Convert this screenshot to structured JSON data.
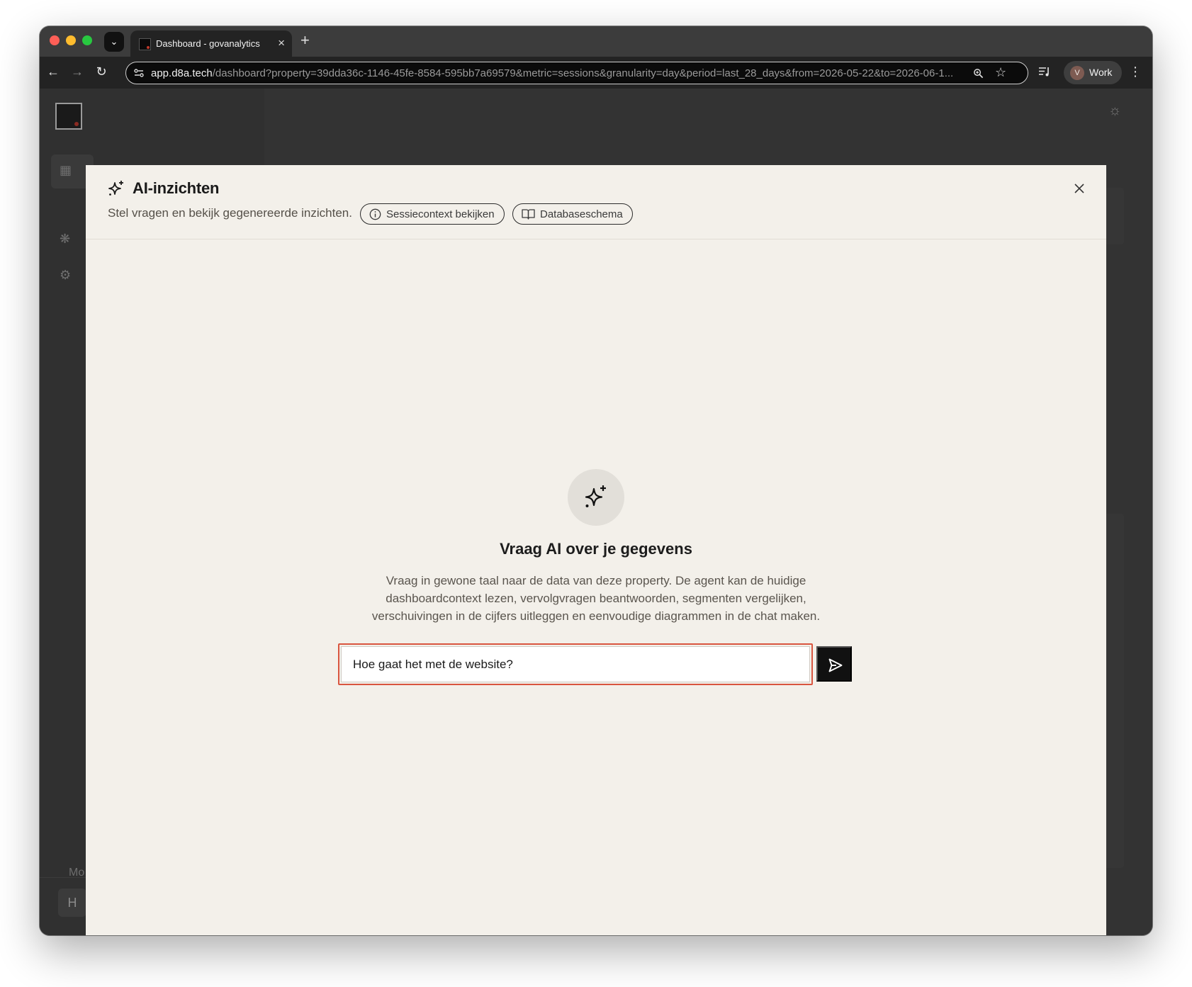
{
  "browser": {
    "tab_title": "Dashboard - govanalytics",
    "tab_close": "×",
    "new_tab": "+",
    "url_host": "app.d8a.tech",
    "url_path": "/dashboard?property=39dda36c-1146-45fe-8584-595bb7a69579&metric=sessions&granularity=day&period=last_28_days&from=2026-05-22&to=2026-06-1...",
    "profile_initial": "V",
    "profile_name": "Work",
    "icons": [
      "tab-list-icon",
      "back-icon",
      "forward-icon",
      "reload-icon",
      "site-info-icon",
      "zoom-icon",
      "bookmark-star-icon",
      "media-controls-icon",
      "menu-kebab-icon"
    ]
  },
  "background_app": {
    "sidebar_footer_label": "Mo",
    "user_initial": "H"
  },
  "modal": {
    "title": "AI-inzichten",
    "subtitle": "Stel vragen en bekijk gegenereerde inzichten.",
    "session_context_button": "Sessiecontext bekijken",
    "database_schema_button": "Databaseschema",
    "empty_state": {
      "title": "Vraag AI over je gegevens",
      "description": "Vraag in gewone taal naar de data van deze property. De agent kan de huidige dashboardcontext lezen, vervolgvragen beantwoorden, segmenten vergelijken, verschuivingen in de cijfers uitleggen en eenvoudige diagrammen in de chat maken."
    },
    "chat_input": {
      "value": "Hoe gaat het met de website?"
    }
  },
  "colors": {
    "modal_background": "#f3f0ea",
    "focus_ring": "#d9553f",
    "send_button": "#111111"
  }
}
